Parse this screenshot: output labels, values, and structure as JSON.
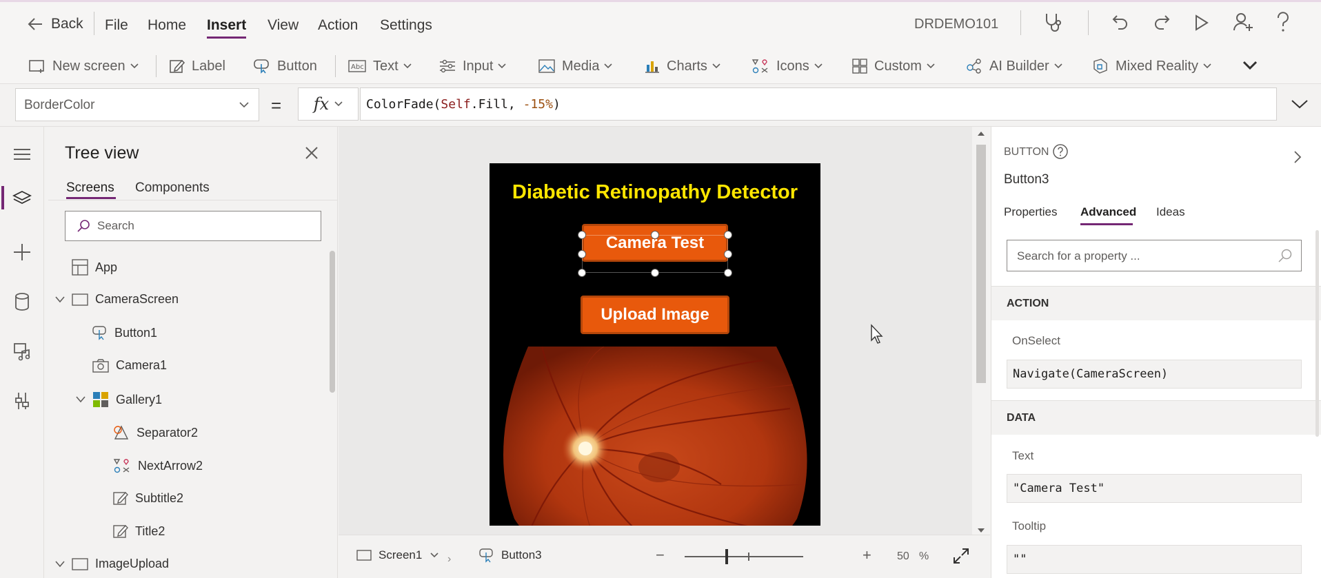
{
  "menu": {
    "back": "Back",
    "items": [
      "File",
      "Home",
      "Insert",
      "View",
      "Action",
      "Settings"
    ],
    "active": "Insert",
    "environment": "DRDEMO101"
  },
  "ribbon": {
    "new_screen": "New screen",
    "label": "Label",
    "button": "Button",
    "text": "Text",
    "input": "Input",
    "media": "Media",
    "charts": "Charts",
    "icons": "Icons",
    "custom": "Custom",
    "ai_builder": "AI Builder",
    "mixed_reality": "Mixed Reality"
  },
  "formula": {
    "property": "BorderColor",
    "equals": "=",
    "fx": "fx",
    "expression": {
      "func": "ColorFade",
      "open": "(",
      "self": "Self",
      "member": ".Fill, ",
      "number": "-15%",
      "close": ")"
    }
  },
  "tree": {
    "title": "Tree view",
    "tabs": [
      "Screens",
      "Components"
    ],
    "active_tab": "Screens",
    "search_placeholder": "Search",
    "items": {
      "app": "App",
      "camera_screen": "CameraScreen",
      "button1": "Button1",
      "camera1": "Camera1",
      "gallery1": "Gallery1",
      "separator2": "Separator2",
      "next_arrow2": "NextArrow2",
      "subtitle2": "Subtitle2",
      "title2": "Title2",
      "image_upload": "ImageUpload"
    }
  },
  "canvas": {
    "app_title": "Diabetic Retinopathy Detector",
    "camera_button": "Camera Test",
    "upload_button": "Upload Image"
  },
  "status": {
    "screen": "Screen1",
    "control": "Button3",
    "zoom_minus": "−",
    "zoom_plus": "+",
    "zoom_value": "50",
    "zoom_unit": "%",
    "zoom_level": 0.5
  },
  "properties": {
    "type": "BUTTON",
    "name": "Button3",
    "tabs": [
      "Properties",
      "Advanced",
      "Ideas"
    ],
    "active_tab": "Advanced",
    "search_placeholder": "Search for a property ...",
    "sections": {
      "action": "ACTION",
      "data": "DATA"
    },
    "onselect_label": "OnSelect",
    "onselect_value": "Navigate(CameraScreen)",
    "text_label": "Text",
    "text_value": "\"Camera Test\"",
    "tooltip_label": "Tooltip",
    "tooltip_value": "\"\""
  },
  "colors": {
    "accent": "#742774",
    "button_fill": "#e8590c",
    "title_yellow": "#ffe600"
  },
  "icons": [
    "back-arrow-icon",
    "stethoscope-icon",
    "undo-icon",
    "redo-icon",
    "play-icon",
    "share-user-icon",
    "help-icon"
  ]
}
